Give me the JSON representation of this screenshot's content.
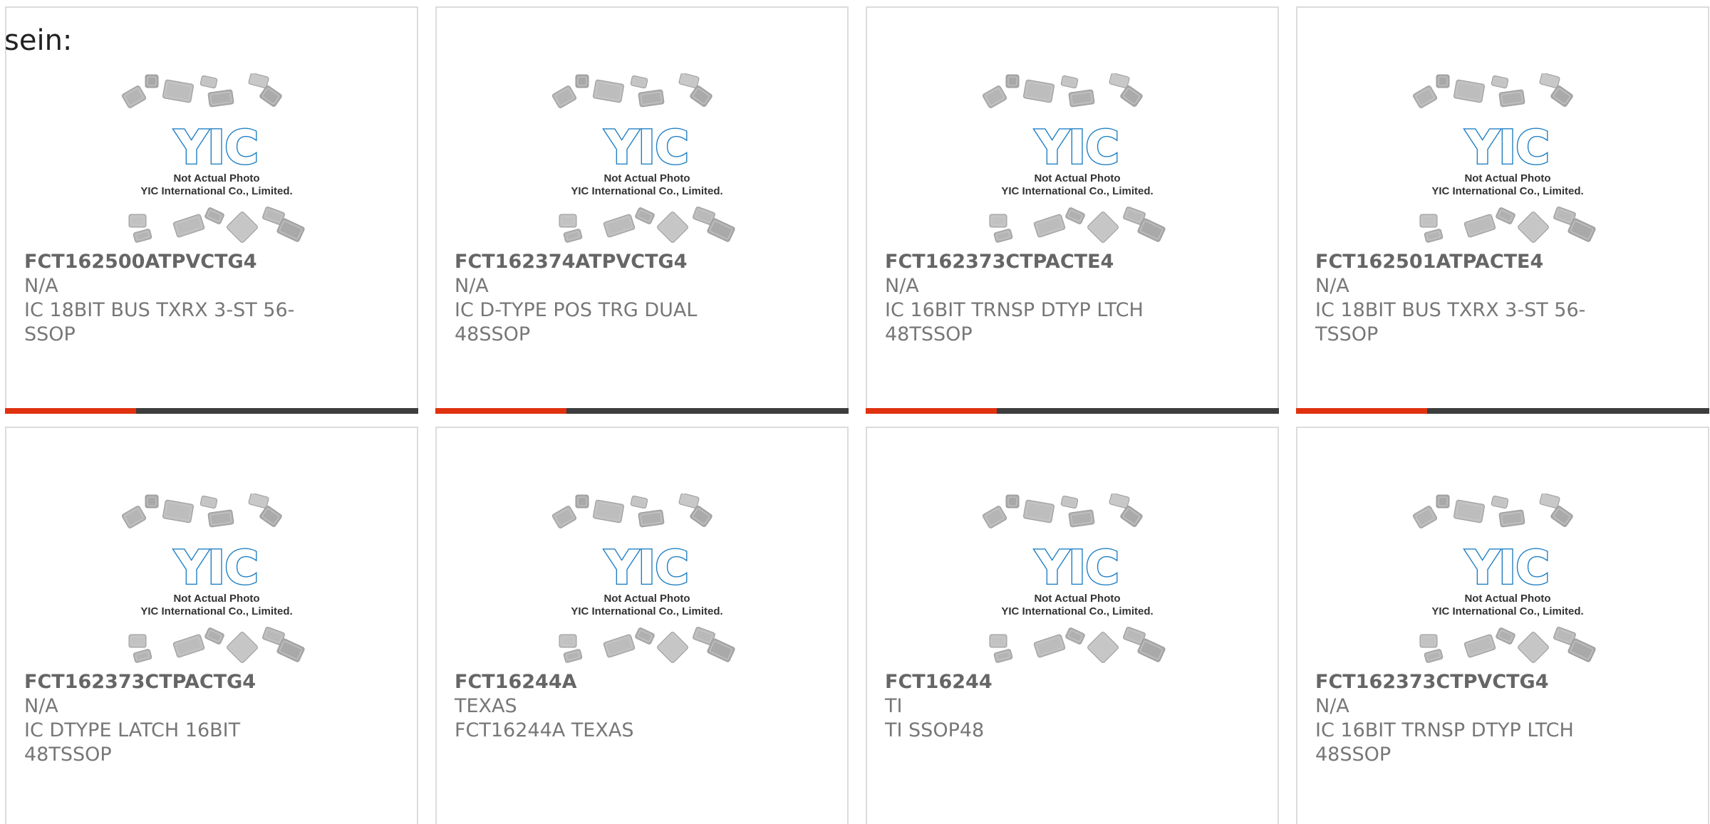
{
  "intro_text": "sein:",
  "placeholder": {
    "logo_text": "YIC",
    "caption_line1": "Not Actual Photo",
    "caption_line2": "YIC International Co., Limited."
  },
  "colors": {
    "accent": "#e0320f",
    "bar": "#3d3d3d",
    "logo": "#1f7fc4",
    "border": "#dcdcdc",
    "text": "#777777"
  },
  "products": [
    {
      "part": "FCT162500ATPVCTG4",
      "mfr": "N/A",
      "desc": "IC 18BIT BUS TXRX 3-ST 56-SSOP"
    },
    {
      "part": "FCT162374ATPVCTG4",
      "mfr": "N/A",
      "desc": "IC D-TYPE POS TRG DUAL 48SSOP"
    },
    {
      "part": "FCT162373CTPACTE4",
      "mfr": "N/A",
      "desc": "IC 16BIT TRNSP DTYP LTCH 48TSSOP"
    },
    {
      "part": "FCT162501ATPACTE4",
      "mfr": "N/A",
      "desc": "IC 18BIT BUS TXRX 3-ST 56-TSSOP"
    },
    {
      "part": "FCT162373CTPACTG4",
      "mfr": "N/A",
      "desc": "IC DTYPE LATCH 16BIT 48TSSOP"
    },
    {
      "part": "FCT16244A",
      "mfr": "TEXAS",
      "desc": "FCT16244A TEXAS"
    },
    {
      "part": "FCT16244",
      "mfr": "TI",
      "desc": "TI SSOP48"
    },
    {
      "part": "FCT162373CTPVCTG4",
      "mfr": "N/A",
      "desc": "IC 16BIT TRNSP DTYP LTCH 48SSOP"
    }
  ]
}
